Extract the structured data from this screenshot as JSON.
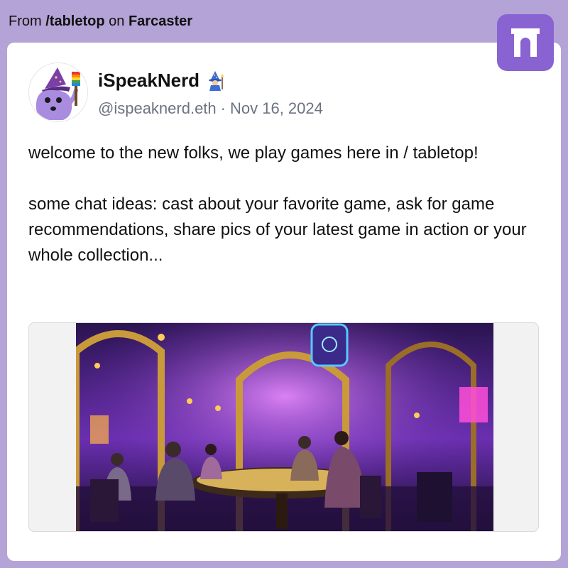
{
  "header": {
    "prefix": "From",
    "channel": "/tabletop",
    "middle": "on",
    "platform": "Farcaster"
  },
  "post": {
    "author_name": "iSpeakNerd",
    "author_badge_icon": "wizard-emoji-icon",
    "handle": "@ispeaknerd.eth",
    "separator": "·",
    "date": "Nov 16, 2024",
    "paragraph_1": "welcome to the new folks, we play games here in / tabletop!",
    "paragraph_2": "some chat ideas: cast about your favorite game, ask for game recommendations, share pics of your latest game in action or your whole collection..."
  },
  "colors": {
    "background": "#b4a3d6",
    "card": "#ffffff",
    "farcaster_purple": "#8a63d2",
    "handle_gray": "#6b7280"
  },
  "icons": {
    "platform_logo": "farcaster-arch-icon",
    "avatar": "purple-wizard-avatar",
    "media": "neon-game-hall-illustration"
  }
}
